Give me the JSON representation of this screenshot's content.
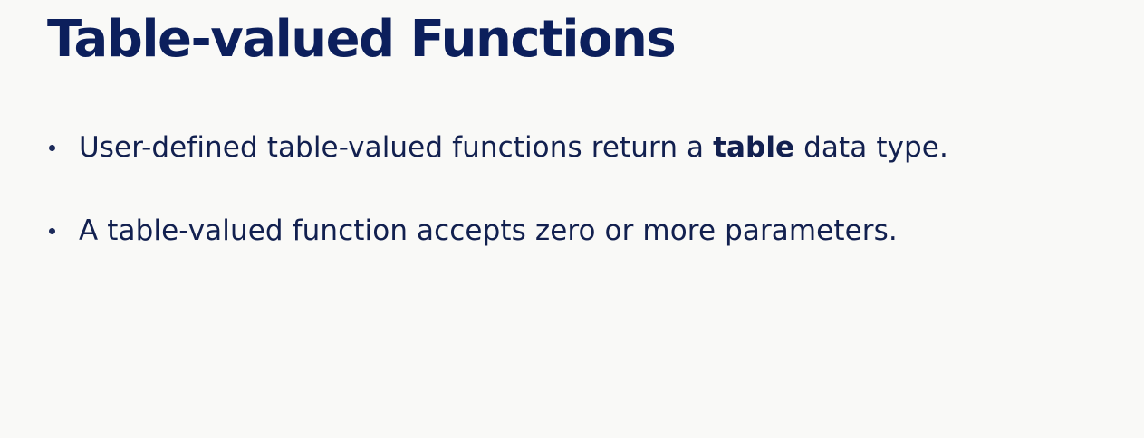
{
  "slide": {
    "title": "Table-valued Functions",
    "bullets": [
      {
        "text_before": "User-defined table-valued functions return a ",
        "text_bold": "table",
        "text_after": " data type."
      },
      {
        "text": "A table-valued function accepts zero or more parameters."
      }
    ]
  },
  "colors": {
    "background": "#f9f9f7",
    "title": "#0c1f5c",
    "body_text": "#12204f"
  }
}
